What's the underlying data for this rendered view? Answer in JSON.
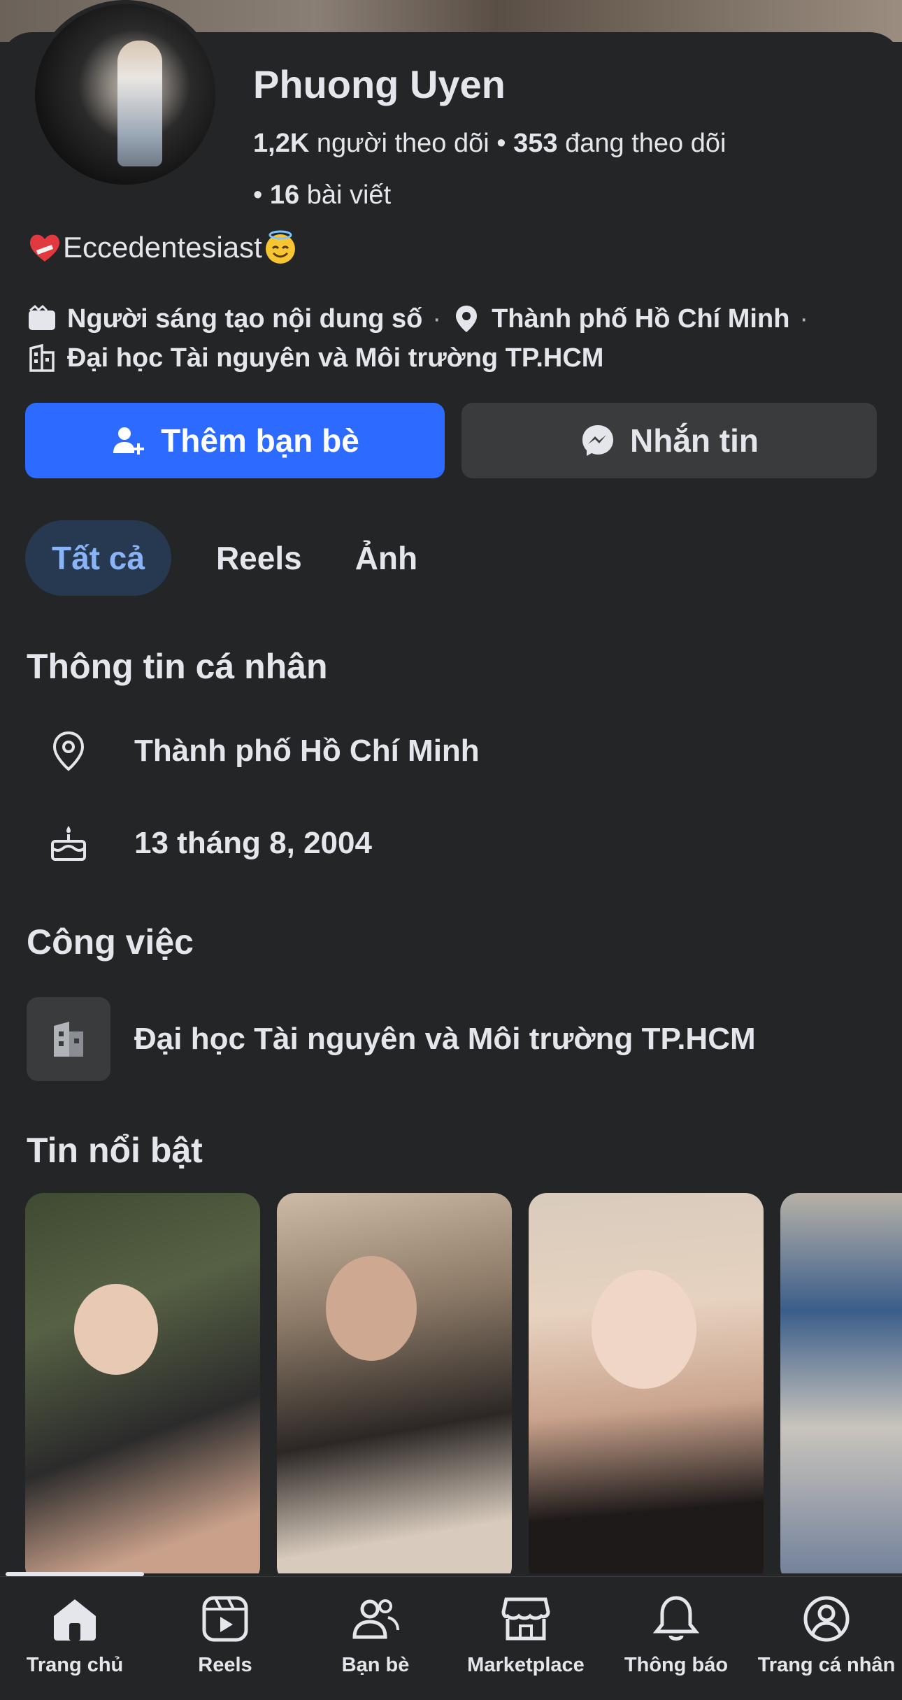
{
  "profile": {
    "name": "Phuong Uyen",
    "followers_count": "1,2K",
    "followers_label": "người theo dõi",
    "following_count": "353",
    "following_label": "đang theo dõi",
    "posts_count": "16",
    "posts_label": "bài viết",
    "bio": "Eccedentesiast",
    "category": "Người sáng tạo nội dung số",
    "city": "Thành phố Hồ Chí Minh",
    "school": "Đại học Tài nguyên và Môi trường TP.HCM"
  },
  "actions": {
    "add_friend": "Thêm bạn bè",
    "message": "Nhắn tin"
  },
  "tabs": [
    {
      "label": "Tất cả"
    },
    {
      "label": "Reels"
    },
    {
      "label": "Ảnh"
    }
  ],
  "personal_info": {
    "heading": "Thông tin cá nhân",
    "location": "Thành phố Hồ Chí Minh",
    "birthday": "13 tháng 8, 2004"
  },
  "work": {
    "heading": "Công việc",
    "item": "Đại học Tài nguyên và Môi trường TP.HCM"
  },
  "highlights": {
    "heading": "Tin nổi bật"
  },
  "bottom_nav": [
    {
      "label": "Trang chủ",
      "icon": "home-icon"
    },
    {
      "label": "Reels",
      "icon": "reels-icon"
    },
    {
      "label": "Bạn bè",
      "icon": "friends-icon"
    },
    {
      "label": "Marketplace",
      "icon": "marketplace-icon"
    },
    {
      "label": "Thông báo",
      "icon": "bell-icon"
    },
    {
      "label": "Trang cá nhân",
      "icon": "profile-icon"
    }
  ],
  "colors": {
    "background": "#242526",
    "primary_button": "#2d6aff",
    "active_tab_bg": "#263951",
    "active_tab_text": "#8ab4f8"
  }
}
